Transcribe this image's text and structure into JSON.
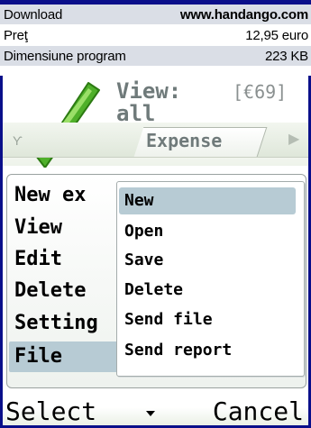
{
  "info": {
    "rows": [
      {
        "label": "Download",
        "value": "www.handango.com"
      },
      {
        "label": "Preţ",
        "value": "12,95 euro"
      },
      {
        "label": "Dimensiune program",
        "value": "223 KB"
      }
    ]
  },
  "app": {
    "title_line1": "View:",
    "title_line2": "all",
    "amount": "[€69]",
    "tab_label": "Expense"
  },
  "options_menu": {
    "items": [
      "New ex",
      "View",
      "Edit",
      "Delete",
      "Setting",
      "File"
    ]
  },
  "submenu": {
    "items": [
      "New",
      "Open",
      "Save",
      "Delete",
      "Send file",
      "Send report"
    ]
  },
  "softkeys": {
    "left": "Select",
    "right": "Cancel"
  },
  "colors": {
    "frame": "#0a0f8a",
    "highlight": "#b7cbd4",
    "table_stripe": "#dadee6"
  },
  "icons": [
    "checkmark-logo-icon",
    "signal-icon",
    "arrow-right-icon",
    "scroll-down-icon"
  ]
}
